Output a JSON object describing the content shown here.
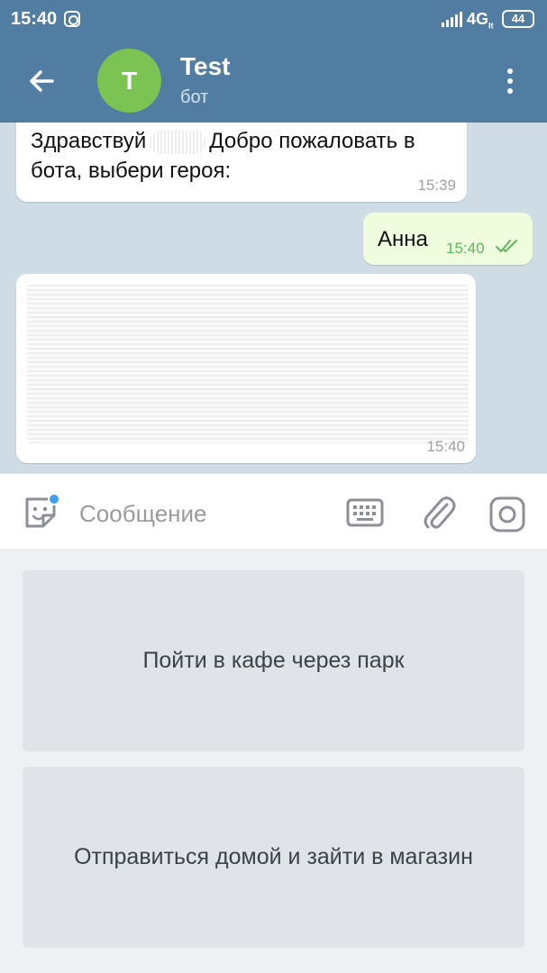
{
  "status_bar": {
    "time": "15:40",
    "network": "4G",
    "network_suffix": "lt",
    "battery": "44"
  },
  "header": {
    "avatar_letter": "T",
    "title": "Test",
    "subtitle": "бот",
    "avatar_color": "#7bc454",
    "bar_color": "#527da3"
  },
  "messages": [
    {
      "text_before": "Здравствуй",
      "text_after": "Добро пожаловать в бота, выбери героя:",
      "time": "15:39",
      "incoming": true
    },
    {
      "text": "Анна",
      "time": "15:40",
      "incoming": false,
      "status": "read"
    },
    {
      "text": "",
      "time": "15:40",
      "incoming": true,
      "redacted": true
    }
  ],
  "composer": {
    "placeholder": "Сообщение"
  },
  "keyboard": {
    "buttons": [
      {
        "label": "Пойти в кафе через парк"
      },
      {
        "label": "Отправиться домой и зайти в магазин"
      }
    ]
  },
  "icons": {
    "back": "back-arrow-icon",
    "menu": "more-vert-icon",
    "sticker": "sticker-icon",
    "keyboard": "keyboard-icon",
    "attach": "paperclip-icon",
    "camera": "camera-icon"
  }
}
